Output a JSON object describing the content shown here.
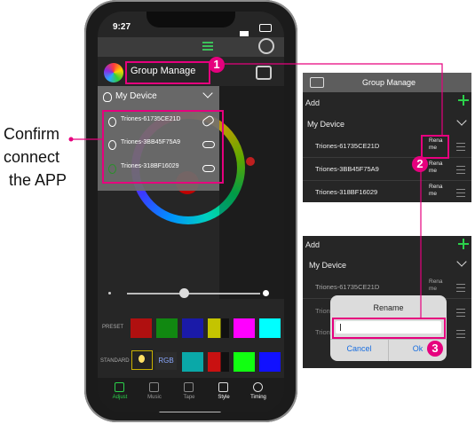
{
  "phone": {
    "time": "9:27",
    "group_title": "Group Manage",
    "device_header": "My Device",
    "devices": [
      "Triones-61735CE21D",
      "Triones-3BB45F75A9",
      "Triones-318BF16029"
    ],
    "preset_label": "PRESET",
    "standard_label": "STANDARD",
    "rgb_label": "RGB",
    "tabs": [
      "Adjust",
      "Music",
      "Tape",
      "Style",
      "Timing"
    ],
    "preset_colors": [
      "#b01010",
      "#118811",
      "#1a1aa8",
      "#c4c400",
      "#ff00ff",
      "#00ffff"
    ],
    "standard_colors": [
      "#0aa8a8",
      "#c91111",
      "#11ff11",
      "#1111ff"
    ]
  },
  "annotation": {
    "line1": "Confirm",
    "line2": "connect",
    "line3": "the APP",
    "steps": [
      "1",
      "2",
      "3"
    ],
    "accent": "#e6007e"
  },
  "panel1": {
    "title": "Group Manage",
    "add": "Add",
    "header": "My Device",
    "rename": "Rena me",
    "devices": [
      "Triones-61735CE21D",
      "Triones-3BB45F75A9",
      "Triones-318BF16029"
    ]
  },
  "panel2": {
    "add": "Add",
    "header": "My Device",
    "first_device": "Triones-61735CE21D",
    "partial_a": "Trion",
    "partial_b": "Trion",
    "rename": "Rena me",
    "dialog_title": "Rename",
    "cancel": "Cancel",
    "ok": "Ok"
  }
}
